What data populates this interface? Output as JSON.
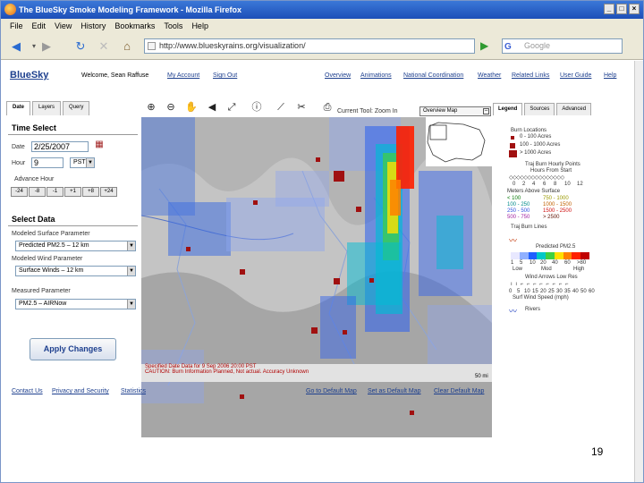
{
  "window": {
    "title": "The BlueSky Smoke Modeling Framework - Mozilla Firefox"
  },
  "menu": [
    "File",
    "Edit",
    "View",
    "History",
    "Bookmarks",
    "Tools",
    "Help"
  ],
  "nav": {
    "url": "http://www.blueskyrains.org/visualization/",
    "search_placeholder": "Google"
  },
  "header": {
    "logo": "BlueSky",
    "welcome": "Welcome, Sean Raffuse",
    "my_account": "My Account",
    "sign_out": "Sign Out",
    "links": [
      "Overview",
      "Animations",
      "National Coordination",
      "Weather",
      "Related Links",
      "User Guide",
      "Help"
    ]
  },
  "left_tabs": [
    "Date",
    "Layers",
    "Query"
  ],
  "time_select": {
    "title": "Time Select",
    "date_label": "Date",
    "date_value": "2/25/2007",
    "hour_label": "Hour",
    "hour_value": "9",
    "tz_value": "PST",
    "advance_label": "Advance Hour",
    "advance_buttons": [
      "-24",
      "-8",
      "-1",
      "+1",
      "+8",
      "+24"
    ]
  },
  "select_data": {
    "title": "Select Data",
    "surface_label": "Modeled Surface Parameter",
    "surface_value": "Predicted PM2.5 – 12 km",
    "wind_label": "Modeled Wind Parameter",
    "wind_value": "Surface Winds – 12 km",
    "measured_label": "Measured Parameter",
    "measured_value": "PM2.5 – AIRNow",
    "apply": "Apply Changes"
  },
  "map": {
    "current_tool": "Current Tool: Zoom In",
    "overview_tab": "Overview Map",
    "minimize": "–",
    "notice": "Specified Date Data for 9 Sep 2006 20:00 PST",
    "caution": "CAUTION: Burn Information Planned, Not actual. Accuracy Unknown",
    "scale": "50 mi"
  },
  "right_tabs": [
    "Legend",
    "Sources",
    "Advanced"
  ],
  "legend": {
    "burn_locations": "Burn Locations",
    "burn_sizes": [
      "0 - 100 Acres",
      "100 - 1000 Acres",
      "> 1000 Acres"
    ],
    "traj_hourly": "Traj Burn Hourly Points",
    "traj_hourly2": "Hours From Start",
    "traj_hours": [
      "0",
      "2",
      "4",
      "6",
      "8",
      "10",
      "12"
    ],
    "meters_label": "Meters Above Surface",
    "meters": [
      "< 100",
      "750 - 1000",
      "100 - 250",
      "1000 - 1500",
      "250 - 500",
      "1500 - 2500",
      "500 - 750",
      "> 2500"
    ],
    "meters_colors": [
      "#0a7a0a",
      "#d0d000",
      "#00a0a0",
      "#e07000",
      "#3050e0",
      "#d01010",
      "#a020a0",
      "#601000"
    ],
    "traj_lines": "Traj Burn Lines",
    "predicted": "Predicted PM2.5",
    "pm_ticks": [
      "1",
      "5",
      "10",
      "20",
      "40",
      "60",
      ">80"
    ],
    "pm_colors": [
      "#e8e8ff",
      "#90b0ff",
      "#2060ff",
      "#00c8c8",
      "#40d040",
      "#ffe000",
      "#ff8000",
      "#ff2000",
      "#c00000"
    ],
    "pm_words": [
      "Low",
      "Mod",
      "High"
    ],
    "wind_arrows": "Wind Arrows Low Res",
    "wind_speeds": [
      "0",
      "5",
      "10",
      "15",
      "20",
      "25",
      "30",
      "35",
      "40",
      "50",
      "60"
    ],
    "wind_speed_label": "Surf Wind Speed (mph)",
    "rivers": "Rivers"
  },
  "footer": {
    "left_links": [
      "Contact Us",
      "Privacy and Security",
      "Statistics"
    ],
    "right_links": [
      "Go to Default Map",
      "Set as Default Map",
      "Clear Default Map"
    ]
  },
  "page_number": "19"
}
